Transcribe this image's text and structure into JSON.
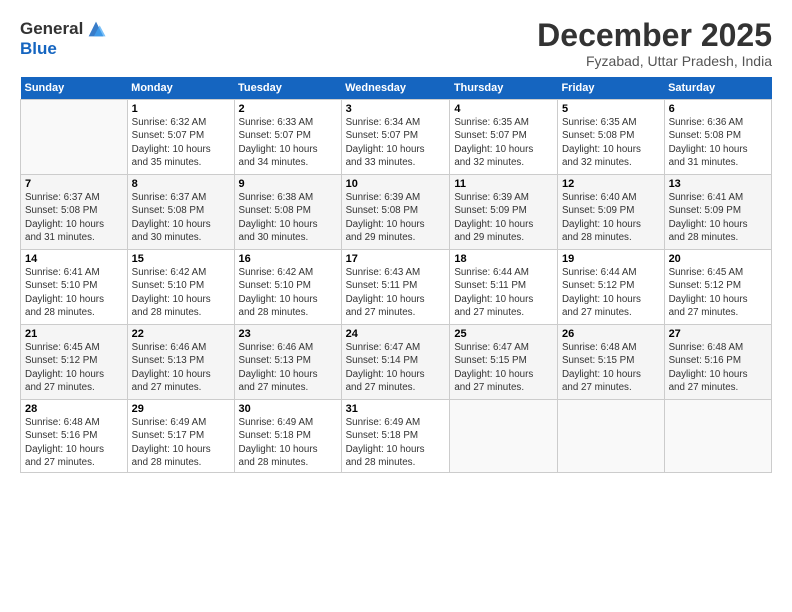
{
  "header": {
    "logo_line1": "General",
    "logo_line2": "Blue",
    "month": "December 2025",
    "location": "Fyzabad, Uttar Pradesh, India"
  },
  "weekdays": [
    "Sunday",
    "Monday",
    "Tuesday",
    "Wednesday",
    "Thursday",
    "Friday",
    "Saturday"
  ],
  "weeks": [
    [
      {
        "day": "",
        "info": ""
      },
      {
        "day": "1",
        "info": "Sunrise: 6:32 AM\nSunset: 5:07 PM\nDaylight: 10 hours\nand 35 minutes."
      },
      {
        "day": "2",
        "info": "Sunrise: 6:33 AM\nSunset: 5:07 PM\nDaylight: 10 hours\nand 34 minutes."
      },
      {
        "day": "3",
        "info": "Sunrise: 6:34 AM\nSunset: 5:07 PM\nDaylight: 10 hours\nand 33 minutes."
      },
      {
        "day": "4",
        "info": "Sunrise: 6:35 AM\nSunset: 5:07 PM\nDaylight: 10 hours\nand 32 minutes."
      },
      {
        "day": "5",
        "info": "Sunrise: 6:35 AM\nSunset: 5:08 PM\nDaylight: 10 hours\nand 32 minutes."
      },
      {
        "day": "6",
        "info": "Sunrise: 6:36 AM\nSunset: 5:08 PM\nDaylight: 10 hours\nand 31 minutes."
      }
    ],
    [
      {
        "day": "7",
        "info": "Sunrise: 6:37 AM\nSunset: 5:08 PM\nDaylight: 10 hours\nand 31 minutes."
      },
      {
        "day": "8",
        "info": "Sunrise: 6:37 AM\nSunset: 5:08 PM\nDaylight: 10 hours\nand 30 minutes."
      },
      {
        "day": "9",
        "info": "Sunrise: 6:38 AM\nSunset: 5:08 PM\nDaylight: 10 hours\nand 30 minutes."
      },
      {
        "day": "10",
        "info": "Sunrise: 6:39 AM\nSunset: 5:08 PM\nDaylight: 10 hours\nand 29 minutes."
      },
      {
        "day": "11",
        "info": "Sunrise: 6:39 AM\nSunset: 5:09 PM\nDaylight: 10 hours\nand 29 minutes."
      },
      {
        "day": "12",
        "info": "Sunrise: 6:40 AM\nSunset: 5:09 PM\nDaylight: 10 hours\nand 28 minutes."
      },
      {
        "day": "13",
        "info": "Sunrise: 6:41 AM\nSunset: 5:09 PM\nDaylight: 10 hours\nand 28 minutes."
      }
    ],
    [
      {
        "day": "14",
        "info": "Sunrise: 6:41 AM\nSunset: 5:10 PM\nDaylight: 10 hours\nand 28 minutes."
      },
      {
        "day": "15",
        "info": "Sunrise: 6:42 AM\nSunset: 5:10 PM\nDaylight: 10 hours\nand 28 minutes."
      },
      {
        "day": "16",
        "info": "Sunrise: 6:42 AM\nSunset: 5:10 PM\nDaylight: 10 hours\nand 28 minutes."
      },
      {
        "day": "17",
        "info": "Sunrise: 6:43 AM\nSunset: 5:11 PM\nDaylight: 10 hours\nand 27 minutes."
      },
      {
        "day": "18",
        "info": "Sunrise: 6:44 AM\nSunset: 5:11 PM\nDaylight: 10 hours\nand 27 minutes."
      },
      {
        "day": "19",
        "info": "Sunrise: 6:44 AM\nSunset: 5:12 PM\nDaylight: 10 hours\nand 27 minutes."
      },
      {
        "day": "20",
        "info": "Sunrise: 6:45 AM\nSunset: 5:12 PM\nDaylight: 10 hours\nand 27 minutes."
      }
    ],
    [
      {
        "day": "21",
        "info": "Sunrise: 6:45 AM\nSunset: 5:12 PM\nDaylight: 10 hours\nand 27 minutes."
      },
      {
        "day": "22",
        "info": "Sunrise: 6:46 AM\nSunset: 5:13 PM\nDaylight: 10 hours\nand 27 minutes."
      },
      {
        "day": "23",
        "info": "Sunrise: 6:46 AM\nSunset: 5:13 PM\nDaylight: 10 hours\nand 27 minutes."
      },
      {
        "day": "24",
        "info": "Sunrise: 6:47 AM\nSunset: 5:14 PM\nDaylight: 10 hours\nand 27 minutes."
      },
      {
        "day": "25",
        "info": "Sunrise: 6:47 AM\nSunset: 5:15 PM\nDaylight: 10 hours\nand 27 minutes."
      },
      {
        "day": "26",
        "info": "Sunrise: 6:48 AM\nSunset: 5:15 PM\nDaylight: 10 hours\nand 27 minutes."
      },
      {
        "day": "27",
        "info": "Sunrise: 6:48 AM\nSunset: 5:16 PM\nDaylight: 10 hours\nand 27 minutes."
      }
    ],
    [
      {
        "day": "28",
        "info": "Sunrise: 6:48 AM\nSunset: 5:16 PM\nDaylight: 10 hours\nand 27 minutes."
      },
      {
        "day": "29",
        "info": "Sunrise: 6:49 AM\nSunset: 5:17 PM\nDaylight: 10 hours\nand 28 minutes."
      },
      {
        "day": "30",
        "info": "Sunrise: 6:49 AM\nSunset: 5:18 PM\nDaylight: 10 hours\nand 28 minutes."
      },
      {
        "day": "31",
        "info": "Sunrise: 6:49 AM\nSunset: 5:18 PM\nDaylight: 10 hours\nand 28 minutes."
      },
      {
        "day": "",
        "info": ""
      },
      {
        "day": "",
        "info": ""
      },
      {
        "day": "",
        "info": ""
      }
    ]
  ]
}
